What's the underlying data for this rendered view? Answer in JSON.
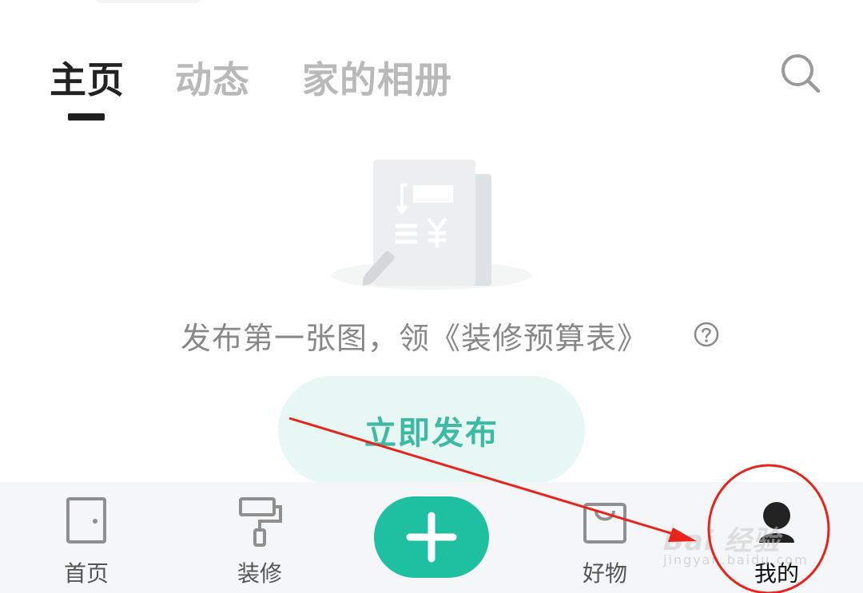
{
  "tabs": [
    {
      "label": "主页",
      "active": true
    },
    {
      "label": "动态",
      "active": false
    },
    {
      "label": "家的相册",
      "active": false
    }
  ],
  "search": {
    "icon": "search-icon"
  },
  "empty_state": {
    "message": "发布第一张图，领《装修预算表》",
    "help_icon": "question-circle-icon",
    "button_label": "立即发布"
  },
  "bottom_nav": [
    {
      "label": "首页",
      "icon": "door-icon"
    },
    {
      "label": "装修",
      "icon": "paint-roller-icon"
    },
    {
      "label": "",
      "icon": "plus-icon"
    },
    {
      "label": "好物",
      "icon": "shopping-bag-icon"
    },
    {
      "label": "我的",
      "icon": "user-avatar-icon",
      "active": true
    }
  ],
  "watermark": {
    "main": "Bai 经验",
    "sub": "jingyan.baidu.com"
  },
  "colors": {
    "accent": "#1fc0a2",
    "button_bg": "#e7f7f3",
    "button_text": "#3db9a4",
    "annotation": "#e8231c"
  }
}
